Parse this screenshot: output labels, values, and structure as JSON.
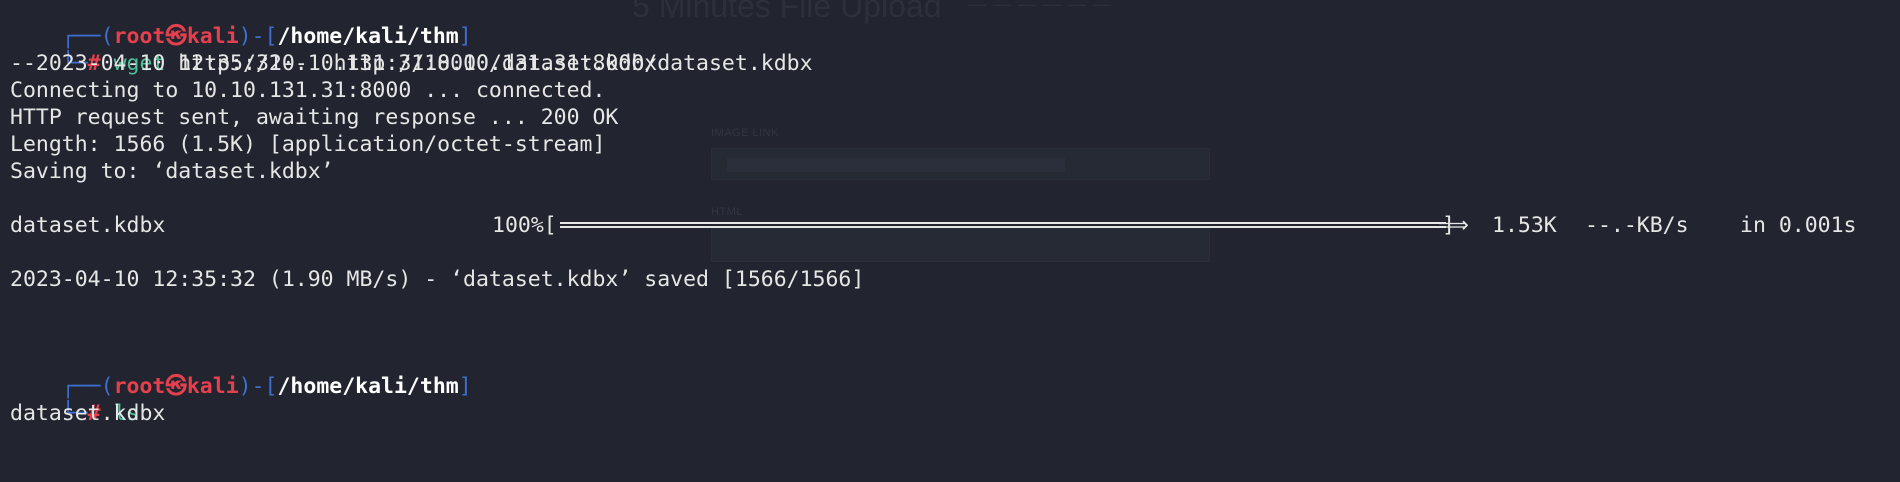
{
  "background_ghost": {
    "title": "5 Minutes File Upload",
    "nav": "— — — —   — —",
    "image_link_label": "IMAGE LINK",
    "html_label": "HTML"
  },
  "prompt1": {
    "frame_top": "┌──(",
    "user": "root",
    "skull": "㉿",
    "host": "kali",
    "sep": ")-[",
    "path": "/home/kali/thm",
    "close": "]",
    "frame_bottom": "└─",
    "hash": "#",
    "command_name": "wget",
    "command_args": " http://10.10.131.31:8000/dataset.kdbx"
  },
  "output": {
    "line1": "--2023-04-10 12:35:32--  http://10.10.131.31:8000/dataset.kdbx",
    "line2": "Connecting to 10.10.131.31:8000 ... connected.",
    "line3": "HTTP request sent, awaiting response ... 200 OK",
    "line4": "Length: 1566 (1.5K) [application/octet-stream]",
    "line5": "Saving to: ‘dataset.kdbx’",
    "progress": {
      "filename": "dataset.kdbx",
      "percent": "100%[",
      "percent_value": 100,
      "arrow": "⟹",
      "end": "]",
      "size": "1.53K",
      "rate": "--.-KB/s",
      "time": "in 0.001s"
    },
    "saved_line": "2023-04-10 12:35:32 (1.90 MB/s) - ‘dataset.kdbx’ saved [1566/1566]"
  },
  "prompt2": {
    "frame_top": "┌──(",
    "user": "root",
    "skull": "㉿",
    "host": "kali",
    "sep": ")-[",
    "path": "/home/kali/thm",
    "close": "]",
    "frame_bottom": "└─",
    "hash": "#",
    "command_name": "ls"
  },
  "ls_output": "dataset.kdbx",
  "colors": {
    "background": "#22252f",
    "frame_blue": "#3d6fd1",
    "root_red": "#e5404e",
    "command_green": "#4ec09a",
    "text": "#e6e6e6"
  }
}
